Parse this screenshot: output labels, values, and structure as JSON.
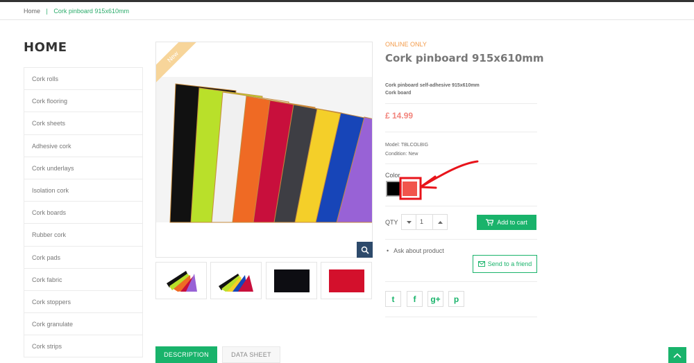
{
  "breadcrumb": {
    "home": "Home",
    "separator": "|",
    "current": "Cork pinboard 915x610mm"
  },
  "sidebar": {
    "title": "HOME",
    "items": [
      {
        "label": "Cork rolls"
      },
      {
        "label": "Cork flooring"
      },
      {
        "label": "Cork sheets"
      },
      {
        "label": "Adhesive cork"
      },
      {
        "label": "Cork underlays"
      },
      {
        "label": "Isolation cork"
      },
      {
        "label": "Cork boards"
      },
      {
        "label": "Rubber cork"
      },
      {
        "label": "Cork pads"
      },
      {
        "label": "Cork fabric"
      },
      {
        "label": "Cork stoppers"
      },
      {
        "label": "Cork granulate"
      },
      {
        "label": "Cork strips"
      }
    ]
  },
  "gallery": {
    "badge": "New",
    "zoom_icon": "search-icon",
    "main_sheet_colors": [
      "#111111",
      "#b9e02a",
      "#f0f0f0",
      "#ef6a24",
      "#c80f3c",
      "#3e3e44",
      "#f4cf29",
      "#1745b8",
      "#9862d6"
    ],
    "thumbnails": [
      "multicolor-fan",
      "multicolor-fan-2",
      "black-sheet",
      "red-sheet"
    ]
  },
  "product": {
    "online_only": "ONLINE ONLY",
    "title": "Cork pinboard 915x610mm",
    "desc_line1": "Cork pinboard self-adhesive 915x610mm",
    "desc_line2": "Cork board",
    "price": "£ 14.99",
    "model": "Model: TBLCOLBIG",
    "condition": "Condition: New",
    "color_label": "Color",
    "colors": [
      {
        "name": "black",
        "hex": "#000000"
      },
      {
        "name": "red",
        "hex": "#f1554c"
      }
    ],
    "qty_label": "QTY",
    "qty_value": "1",
    "add_to_cart": "Add to cart",
    "ask": "Ask about product",
    "send_friend": "Send to a friend",
    "social": [
      {
        "icon": "twitter-icon",
        "glyph": "t"
      },
      {
        "icon": "facebook-icon",
        "glyph": "f"
      },
      {
        "icon": "google-plus-icon",
        "glyph": "g+"
      },
      {
        "icon": "pinterest-icon",
        "glyph": "p"
      }
    ]
  },
  "tabs": {
    "description": "DESCRIPTION",
    "data_sheet": "DATA SHEET"
  },
  "accent": "#19b36b",
  "annotation_color": "#e8141b"
}
